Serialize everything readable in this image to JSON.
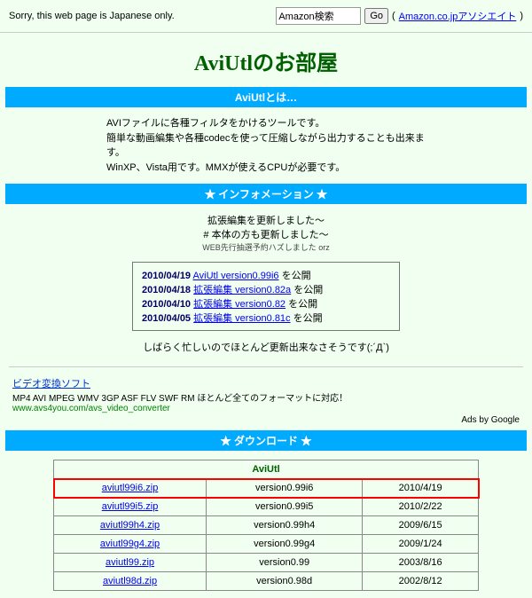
{
  "top": {
    "notice": "Sorry, this web page is Japanese only.",
    "search_value": "Amazon検索",
    "go": "Go",
    "assoc": "Amazon.co.jpアソシエイト"
  },
  "page_title": "AviUtlのお部屋",
  "s1": {
    "header": "AviUtlとは…",
    "l1": "AVIファイルに各種フィルタをかけるツールです。",
    "l2": "簡単な動画編集や各種codecを使って圧縮しながら出力することも出来ます。",
    "l3": "WinXP、Vista用です。MMXが使えるCPUが必要です。"
  },
  "s2": {
    "header": "★ インフォメーション ★",
    "l1": "拡張編集を更新しました～",
    "l2": "# 本体の方も更新しました～",
    "l3": "WEB先行抽選予約ハズしました orz"
  },
  "updates": [
    {
      "date": "2010/04/19",
      "link": "AviUtl version0.99i6",
      "tail": "を公開"
    },
    {
      "date": "2010/04/18",
      "link": "拡張編集 version0.82a",
      "tail": "を公開"
    },
    {
      "date": "2010/04/10",
      "link": "拡張編集 version0.82",
      "tail": "を公開"
    },
    {
      "date": "2010/04/05",
      "link": "拡張編集 version0.81c",
      "tail": "を公開"
    }
  ],
  "apology": "しばらく忙しいのでほとんど更新出来なさそうです(;´Д`)",
  "ad": {
    "title": "ビデオ変換ソフト",
    "sub": "MP4 AVI MPEG WMV 3GP ASF FLV SWF RM ほとんど全てのフォーマットに対応！",
    "url": "www.avs4you.com/avs_video_converter",
    "by": "Ads by Google"
  },
  "s3": {
    "header": "★ ダウンロード ★",
    "table_title": "AviUtl"
  },
  "rows": [
    {
      "file": "aviutl99i6.zip",
      "ver": "version0.99i6",
      "date": "2010/4/19"
    },
    {
      "file": "aviutl99i5.zip",
      "ver": "version0.99i5",
      "date": "2010/2/22"
    },
    {
      "file": "aviutl99h4.zip",
      "ver": "version0.99h4",
      "date": "2009/6/15"
    },
    {
      "file": "aviutl99g4.zip",
      "ver": "version0.99g4",
      "date": "2009/1/24"
    },
    {
      "file": "aviutl99.zip",
      "ver": "version0.99",
      "date": "2003/8/16"
    },
    {
      "file": "aviutl98d.zip",
      "ver": "version0.98d",
      "date": "2002/8/12"
    }
  ]
}
